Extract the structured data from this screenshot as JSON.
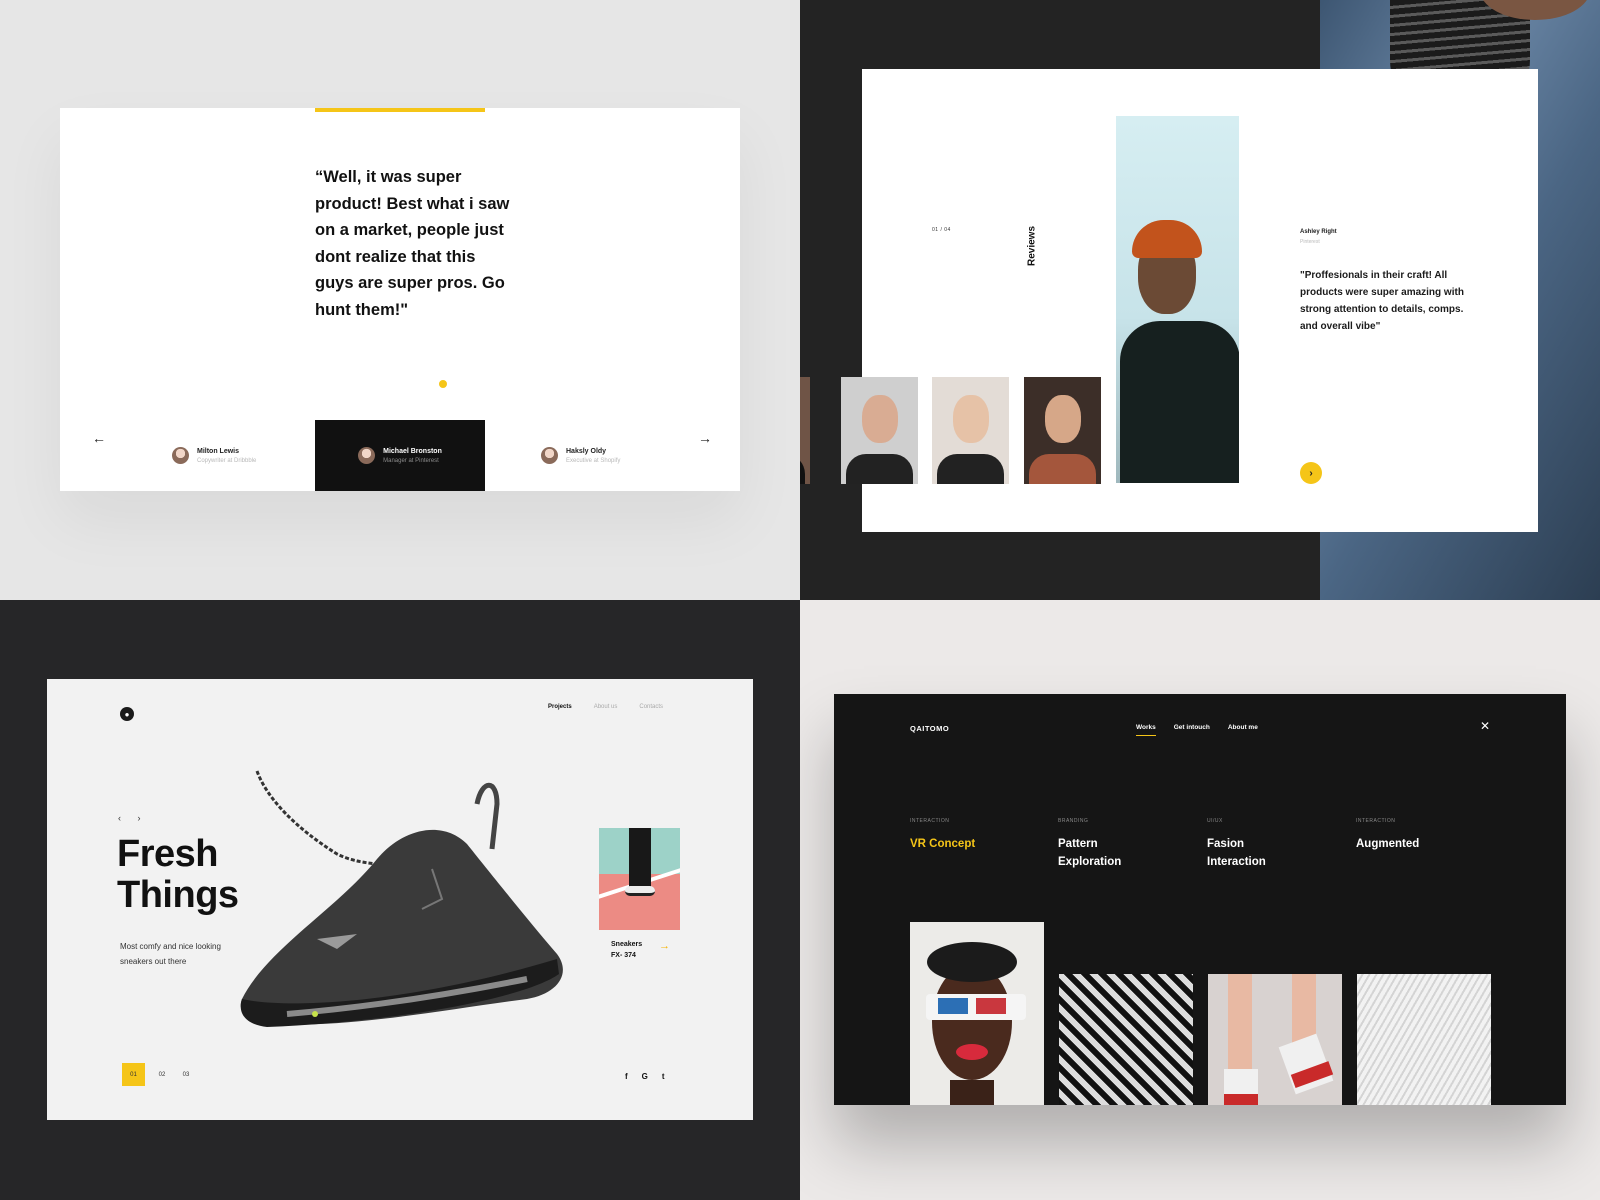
{
  "testimonial": {
    "quote": "“Well, it was super product! Best what i saw on a market, people just dont realize that this guys are super pros. Go hunt them!\"",
    "prev_icon": "arrow-left-icon",
    "next_icon": "arrow-right-icon",
    "accent_color": "#f5c518",
    "people": [
      {
        "name": "Milton Lewis",
        "role": "Copywriter at Dribbble"
      },
      {
        "name": "Michael Bronston",
        "role": "Manager at Pinterest"
      },
      {
        "name": "Haksly Oldy",
        "role": "Executive at Shopify"
      }
    ]
  },
  "reviews": {
    "counter": "01 / 04",
    "section_label": "Reviews",
    "author_name": "Ashley Right",
    "author_company": "Pinterest",
    "quote": "\"Proffesionals in their craft! All products were super amazing with strong attention to details, comps. and overall vibe\"",
    "next_icon": "chevron-right-icon"
  },
  "sneakers": {
    "logo_icon": "brand-logo-icon",
    "nav": [
      "Projects",
      "About us",
      "Contacts"
    ],
    "title_line1": "Fresh",
    "title_line2": "Things",
    "subtitle": "Most comfy and nice looking sneakers out there",
    "product_line1": "Sneakers",
    "product_line2": "FX- 374",
    "pages": [
      "01",
      "02",
      "03"
    ],
    "social": [
      "f",
      "G",
      "t"
    ]
  },
  "portfolio": {
    "logo": "QAITOMO",
    "nav": [
      "Works",
      "Get intouch",
      "About me"
    ],
    "close_icon": "close-icon",
    "projects": [
      {
        "category": "INTERACTION",
        "title": "VR Concept"
      },
      {
        "category": "BRANDING",
        "title": "Pattern Exploration"
      },
      {
        "category": "UI/UX",
        "title": "Fasion Interaction"
      },
      {
        "category": "INTERACTION",
        "title": "Augmented"
      }
    ]
  }
}
